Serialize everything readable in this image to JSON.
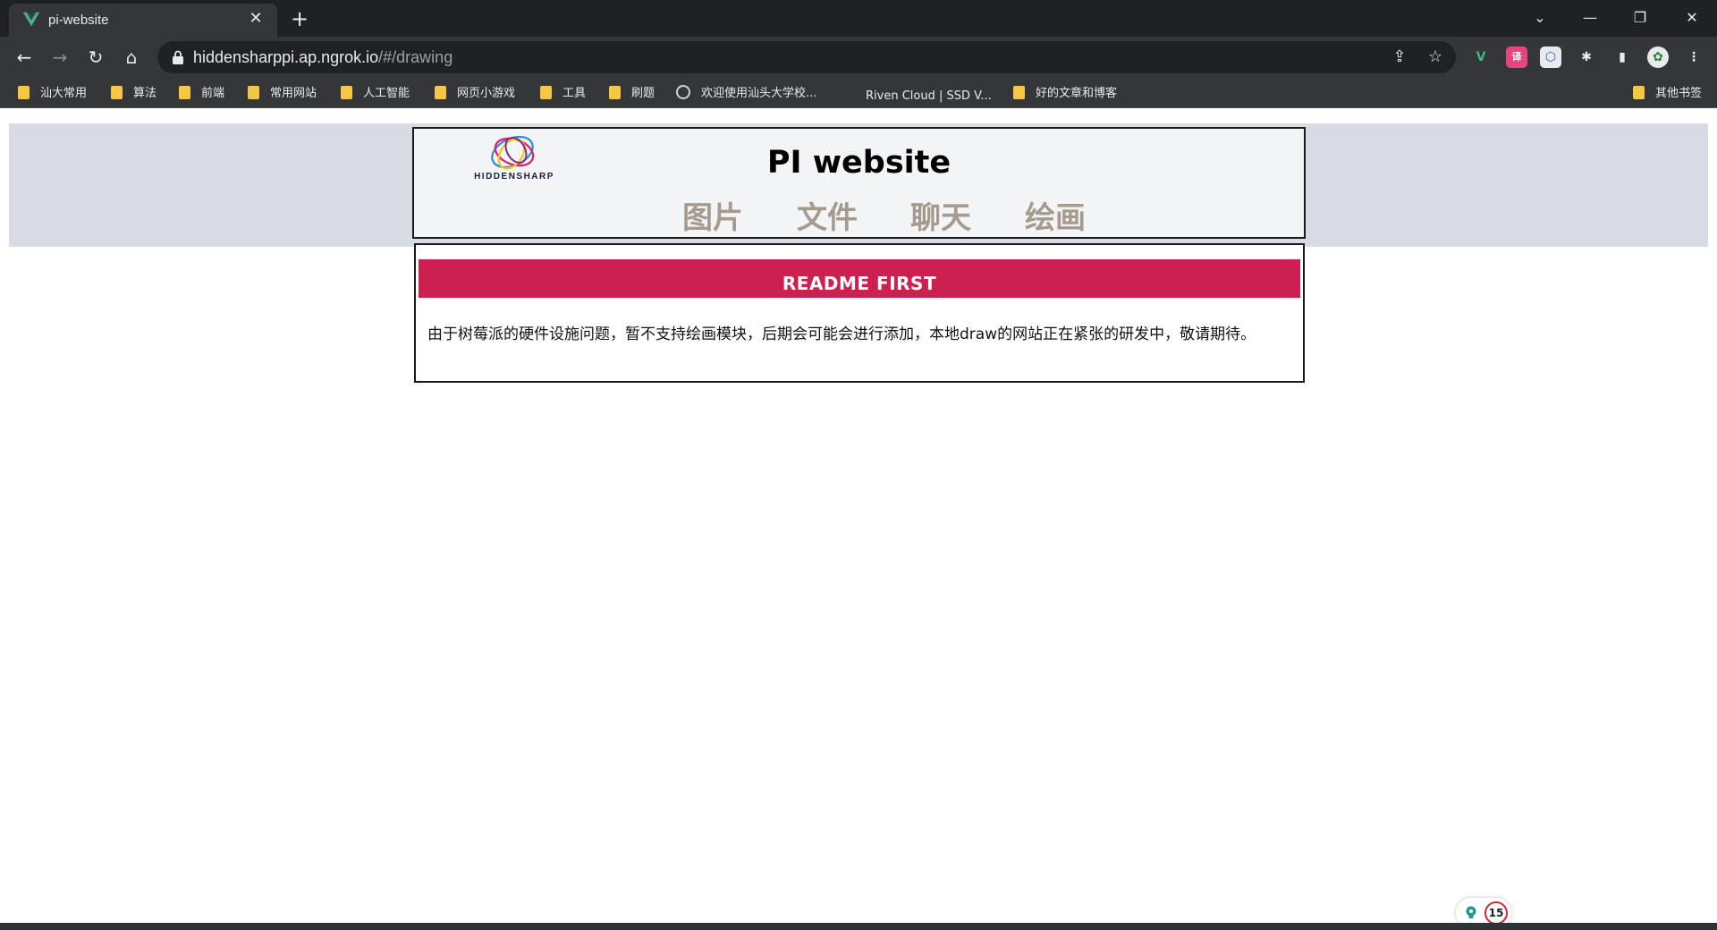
{
  "browser": {
    "tab_title": "pi-website",
    "url_host": "hiddensharppi.ap.ngrok.io",
    "url_path": "/#/drawing",
    "bookmarks": [
      {
        "label": "汕大常用",
        "icon": "folder-icon"
      },
      {
        "label": "算法",
        "icon": "folder-icon"
      },
      {
        "label": "前端",
        "icon": "folder-icon"
      },
      {
        "label": "常用网站",
        "icon": "folder-icon"
      },
      {
        "label": "人工智能",
        "icon": "folder-icon"
      },
      {
        "label": "网页小游戏",
        "icon": "folder-icon"
      },
      {
        "label": "工具",
        "icon": "folder-icon"
      },
      {
        "label": "刷题",
        "icon": "folder-icon"
      },
      {
        "label": "欢迎使用汕头大学校...",
        "icon": "globe-icon"
      },
      {
        "label": "Riven Cloud | SSD V...",
        "icon": "blank-icon"
      },
      {
        "label": "好的文章和博客",
        "icon": "folder-icon"
      }
    ],
    "other_bookmarks": "其他书签"
  },
  "site": {
    "logo_text": "HIDDENSHARP",
    "title": "PI website",
    "nav": [
      "图片",
      "文件",
      "聊天",
      "绘画"
    ]
  },
  "content": {
    "banner": "README FIRST",
    "notice": "由于树莓派的硬件设施问题，暂不支持绘画模块，后期会可能会进行添加，本地draw的网站正在紧张的研发中，敬请期待。"
  },
  "widget": {
    "count": "15"
  },
  "colors": {
    "banner": "#cc2150",
    "nav_link": "#a59a8e",
    "header_band": "#d8dbe3",
    "chrome_dark": "#202124",
    "chrome_toolbar": "#35363a"
  }
}
